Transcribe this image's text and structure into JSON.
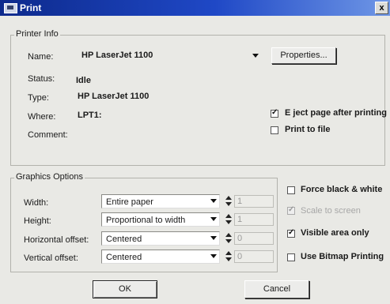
{
  "window": {
    "title": "Print",
    "close_glyph": "x"
  },
  "printer_info": {
    "group_label": "Printer Info",
    "name_label": "Name:",
    "name_value": "HP LaserJet 1100",
    "properties_button": "Properties...",
    "status_label": "Status:",
    "status_value": "Idle",
    "type_label": "Type:",
    "type_value": "HP LaserJet 1100",
    "where_label": "Where:",
    "where_value": "LPT1:",
    "comment_label": "Comment:",
    "eject_checkbox": {
      "label": "E ject page after printing",
      "checked": true
    },
    "print_to_file_checkbox": {
      "label": "Print to file",
      "checked": false
    }
  },
  "graphics_options": {
    "group_label": "Graphics Options",
    "width_label": "Width:",
    "width_value": "Entire paper",
    "width_number": "1",
    "height_label": "Height:",
    "height_value": "Proportional to width",
    "height_number": "1",
    "hoffset_label": "Horizontal offset:",
    "hoffset_value": "Centered",
    "hoffset_number": "0",
    "voffset_label": "Vertical offset:",
    "voffset_value": "Centered",
    "voffset_number": "0",
    "force_bw_checkbox": {
      "label": "Force black & white",
      "checked": false
    },
    "scale_checkbox": {
      "label": "Scale to screen",
      "checked": true,
      "disabled": true
    },
    "visible_area_checkbox": {
      "label": "Visible area only",
      "checked": true
    },
    "bitmap_checkbox": {
      "label": "Use Bitmap Printing",
      "checked": false
    }
  },
  "buttons": {
    "ok": "OK",
    "cancel": "Cancel"
  },
  "colors": {
    "titlebar_start": "#0d2a8c",
    "titlebar_end": "#6f97e6",
    "dialog_bg": "#e9e9e5"
  }
}
